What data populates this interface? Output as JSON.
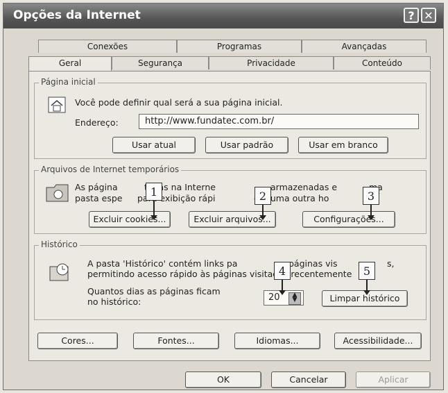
{
  "window": {
    "title": "Opções da Internet"
  },
  "titlebar_buttons": {
    "help": "?",
    "close": "✕"
  },
  "tabs": {
    "back_row": [
      "Conexões",
      "Programas",
      "Avançadas"
    ],
    "front_row": [
      "Geral",
      "Segurança",
      "Privacidade",
      "Conteúdo"
    ]
  },
  "home_page": {
    "group_label": "Página inicial",
    "description": "Você pode definir qual será a sua página inicial.",
    "address_label": "Endereço:",
    "address_value": "http://www.fundatec.com.br/",
    "buttons": {
      "use_current": "Usar atual",
      "use_default": "Usar padrão",
      "use_blank": "Usar em branco"
    }
  },
  "temp_files": {
    "group_label": "Arquivos de Internet temporários",
    "desc_line1_a": "As página",
    "desc_line1_b": "tadas na Interne",
    "desc_line1_c": "armazenadas e",
    "desc_line1_d": "ma",
    "desc_line2_a": "pasta espe",
    "desc_line2_b": "para exibição rápi",
    "desc_line2_c": "em uma outra ho",
    "buttons": {
      "delete_cookies": "Excluir cookies...",
      "delete_files": "Excluir arquivos...",
      "settings": "Configurações..."
    }
  },
  "history": {
    "group_label": "Histórico",
    "desc_line1_a": "A pasta 'Histórico' contém links pa",
    "desc_line1_b": "páginas vis",
    "desc_line1_c": "s,",
    "desc_line2": "permitindo acesso rápido às páginas visitadas recentemente",
    "days_label_1": "Quantos dias as páginas ficam",
    "days_label_2": "no histórico:",
    "days_value": "20",
    "clear_button": "Limpar histórico"
  },
  "bottom_buttons": {
    "colors": "Cores...",
    "fonts": "Fontes...",
    "languages": "Idiomas...",
    "accessibility": "Acessibilidade..."
  },
  "dialog_buttons": {
    "ok": "OK",
    "cancel": "Cancelar",
    "apply": "Aplicar"
  },
  "markers": [
    "1",
    "2",
    "3",
    "4",
    "5"
  ]
}
